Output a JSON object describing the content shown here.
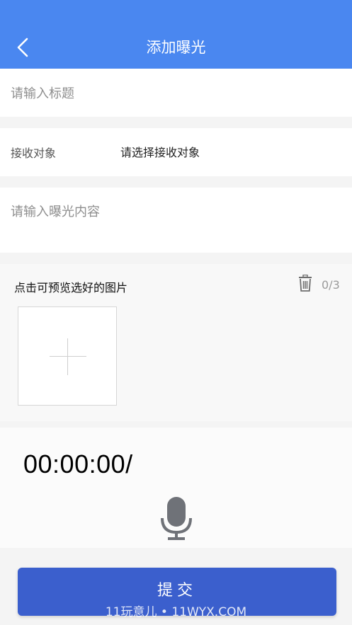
{
  "header": {
    "title": "添加曝光",
    "back_icon": "chevron-left-icon",
    "background_color": "#4a87f0"
  },
  "form": {
    "title_placeholder": "请输入标题",
    "receiver": {
      "label": "接收对象",
      "value": "请选择接收对象"
    },
    "content_placeholder": "请输入曝光内容"
  },
  "photos": {
    "hint": "点击可预览选好的图片",
    "count": "0/3",
    "delete_icon": "trash-icon",
    "add_icon": "plus-icon"
  },
  "audio": {
    "timer": "00:00:00/",
    "mic_icon": "microphone-icon"
  },
  "submit": {
    "label": "提交",
    "color": "#3b5fcd"
  },
  "watermark": "11玩意儿 • 11WYX.COM"
}
